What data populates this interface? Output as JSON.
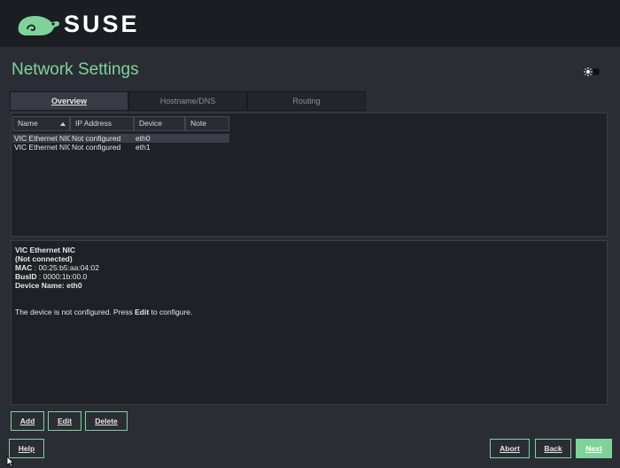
{
  "brand": {
    "name": "SUSE"
  },
  "page": {
    "title": "Network Settings"
  },
  "tabs": [
    {
      "label": "Overview",
      "active": true
    },
    {
      "label": "Hostname/DNS",
      "active": false
    },
    {
      "label": "Routing",
      "active": false
    }
  ],
  "table": {
    "columns": [
      "Name",
      "IP Address",
      "Device",
      "Note"
    ],
    "rows": [
      [
        "VIC Ethernet NIC",
        "Not configured",
        "eth0",
        ""
      ],
      [
        "VIC Ethernet NIC",
        "Not configured",
        "eth1",
        ""
      ]
    ]
  },
  "details": {
    "name": "VIC Ethernet NIC",
    "status": "(Not connected)",
    "mac_label": "MAC",
    "mac_value": " : 00:25:b5:aa:04:02",
    "busid_label": "BusID",
    "busid_value": " : 0000:1b:00.0",
    "device_label": "Device Name: eth0",
    "message_pre": "The device is not configured. Press ",
    "message_bold": "Edit",
    "message_post": " to configure."
  },
  "buttons": {
    "add": "Add",
    "edit": "Edit",
    "delete": "Delete",
    "help": "Help",
    "abort": "Abort",
    "back": "Back",
    "next": "Next"
  },
  "colors": {
    "accent": "#7fd39a",
    "background": "#2b2d34",
    "header": "#1b1d23"
  }
}
